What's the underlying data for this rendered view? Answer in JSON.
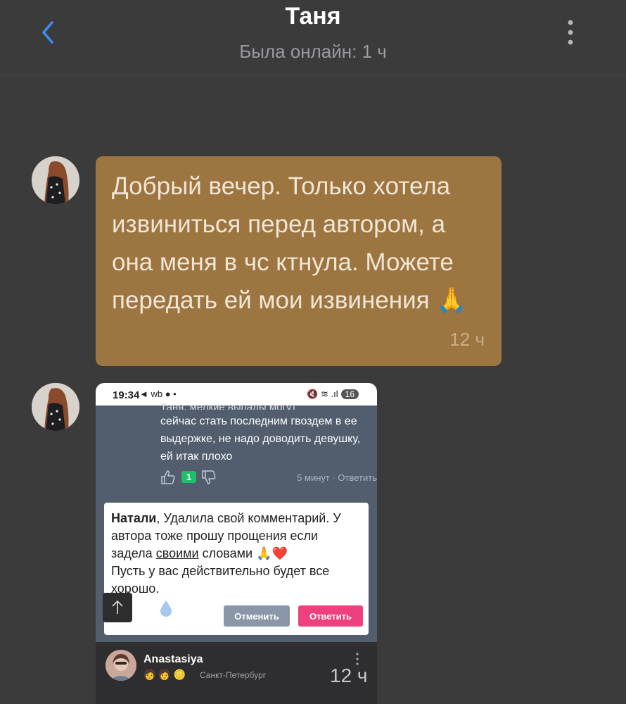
{
  "header": {
    "title": "Таня",
    "subtitle": "Была онлайн: 1 ч",
    "back_icon": "chevron-left-icon",
    "menu_icon": "kebab-menu-icon",
    "accent_color": "#3d8eef"
  },
  "messages": [
    {
      "type": "text",
      "text": "Добрый вечер. Только хотела извиниться перед автором, а она меня в чс ктнула. Можете передать ей мои извинения 🙏",
      "time": "12 ч",
      "bubble_color": "#9c7541"
    },
    {
      "type": "image",
      "time": "12 ч",
      "screenshot": {
        "status_bar": {
          "time": "19:34",
          "icons": "◄ wb ● •",
          "right_icons": "🔇 ≋ .ıl",
          "battery": "16"
        },
        "comment": {
          "cut_text": "Таня, мелкие выпады могут",
          "text": "сейчас стать последним гвоздем в ее выдержке, не надо доводить девушку, ей итак плохо",
          "likes": "1",
          "age": "5 минут",
          "reply_link": "Ответить"
        },
        "reply_box": {
          "mention": "Натали",
          "text_1": ", Удалила свой комментарий. У автора тоже прошу прощения если задела ",
          "underlined": "своими",
          "text_2": " словами 🙏❤️",
          "text_3": "Пусть у вас действительно будет все хорошо.",
          "cancel_label": "Отменить",
          "reply_label": "Ответить"
        },
        "user": {
          "name": "Anastasiya",
          "badges": "🧑 🧑 🪙",
          "city": "Санкт-Петербург"
        }
      }
    }
  ]
}
